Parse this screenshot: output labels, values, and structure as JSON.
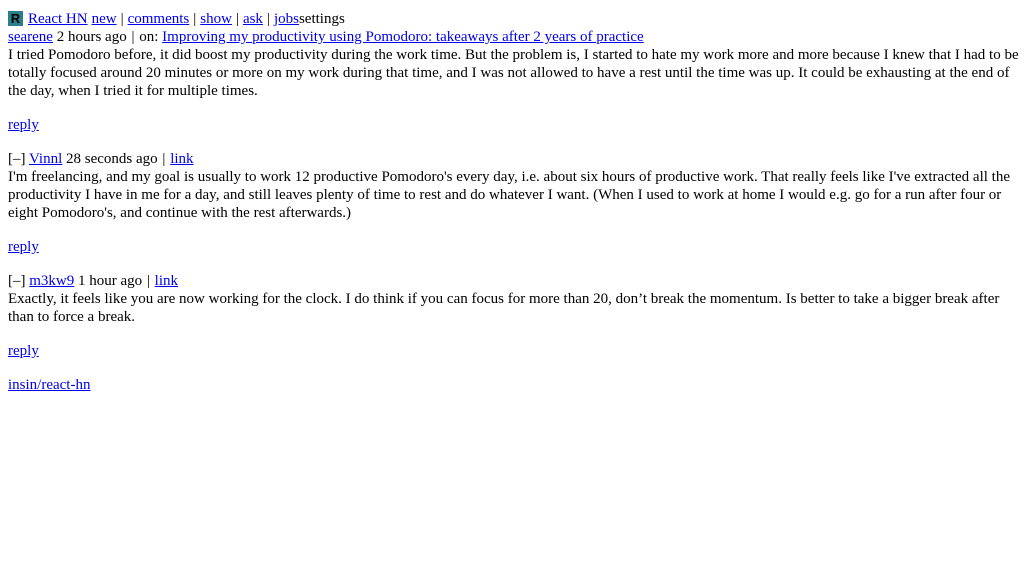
{
  "header": {
    "logo_letter": "R",
    "app_name": "React HN",
    "nav": [
      "new",
      "comments",
      "show",
      "ask",
      "jobs"
    ],
    "settings_label": "settings"
  },
  "root_comment": {
    "author": "searene",
    "age": "2 hours ago",
    "on_label": "on:",
    "story_title": "Improving my productivity using Pomodoro: takeaways after 2 years of practice",
    "text": "I tried Pomodoro before, it did boost my productivity during the work time. But the problem is, I started to hate my work more and more because I knew that I had to be totally focused around 20 minutes or more on my work during that time, and I was not allowed to have a rest until the time was up. It could be exhausting at the end of the day, when I tried it for multiple times.",
    "reply_label": "reply"
  },
  "comments": [
    {
      "toggle": "[–]",
      "author": "Vinnl",
      "age": "28 seconds ago",
      "link_label": "link",
      "text": "I'm freelancing, and my goal is usually to work 12 productive Pomodoro's every day, i.e. about six hours of productive work. That really feels like I've extracted all the productivity I have in me for a day, and still leaves plenty of time to rest and do whatever I want. (When I used to work at home I would e.g. go for a run after four or eight Pomodoro's, and continue with the rest afterwards.)",
      "reply_label": "reply"
    },
    {
      "toggle": "[–]",
      "author": "m3kw9",
      "age": "1 hour ago",
      "link_label": "link",
      "text": "Exactly, it feels like you are now working for the clock. I do think if you can focus for more than 20, don’t break the momentum. Is better to take a bigger break after than to force a break.",
      "reply_label": "reply"
    }
  ],
  "footer": {
    "repo_link": "insin/react-hn"
  }
}
